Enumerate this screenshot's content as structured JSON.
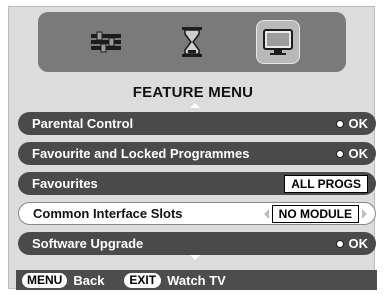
{
  "menu": {
    "title": "FEATURE MENU",
    "icons": [
      "settings-sliders-icon",
      "hourglass-icon",
      "tv-icon"
    ],
    "items": [
      {
        "label": "Parental Control",
        "value": "OK",
        "value_type": "ok",
        "selected": false
      },
      {
        "label": "Favourite and Locked Programmes",
        "value": "OK",
        "value_type": "ok",
        "selected": false
      },
      {
        "label": "Favourites",
        "value": "ALL PROGS",
        "value_type": "box",
        "selected": false
      },
      {
        "label": "Common Interface Slots",
        "value": "NO MODULE",
        "value_type": "box-arrows",
        "selected": true
      },
      {
        "label": "Software Upgrade",
        "value": "OK",
        "value_type": "ok",
        "selected": false
      }
    ]
  },
  "footer": {
    "menu_key": "MENU",
    "menu_action": "Back",
    "exit_key": "EXIT",
    "exit_action": "Watch TV"
  },
  "colors": {
    "panel": "#dcdcdc",
    "icon_bar": "#7a7a7a",
    "row_dark": "#4a4a4a",
    "row_selected": "#ffffff",
    "footer": "#4d4d4d"
  }
}
